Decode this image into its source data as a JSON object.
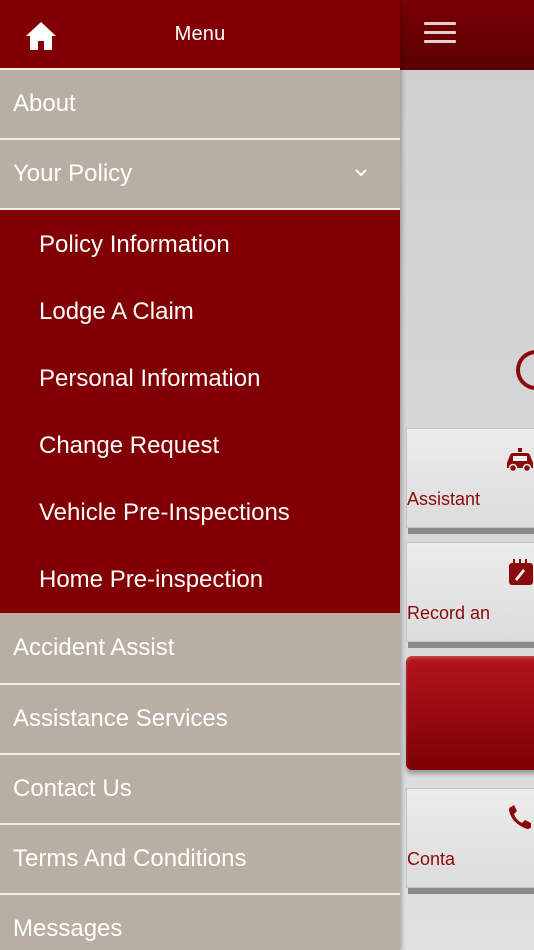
{
  "header": {
    "title": "Menu",
    "home_icon": "home-icon"
  },
  "topbar": {
    "menu_icon": "hamburger-icon"
  },
  "menu": {
    "about": "About",
    "your_policy": "Your Policy",
    "your_policy_expanded": true,
    "submenu": [
      "Policy Information",
      "Lodge A Claim",
      "Personal Information",
      "Change Request",
      "Vehicle Pre-Inspections",
      "Home Pre-inspection"
    ],
    "accident_assist": "Accident Assist",
    "assistance_services": "Assistance Services",
    "contact_us": "Contact Us",
    "terms": "Terms And Conditions",
    "messages": "Messages"
  },
  "background_tiles": [
    {
      "label": "Assistant",
      "icon": "car-icon"
    },
    {
      "label": "Record an",
      "icon": "calendar-icon"
    },
    {
      "label": "Conta",
      "icon": "phone-icon"
    }
  ],
  "colors": {
    "brand_red": "#800004",
    "menu_gray": "#b9aea2"
  }
}
